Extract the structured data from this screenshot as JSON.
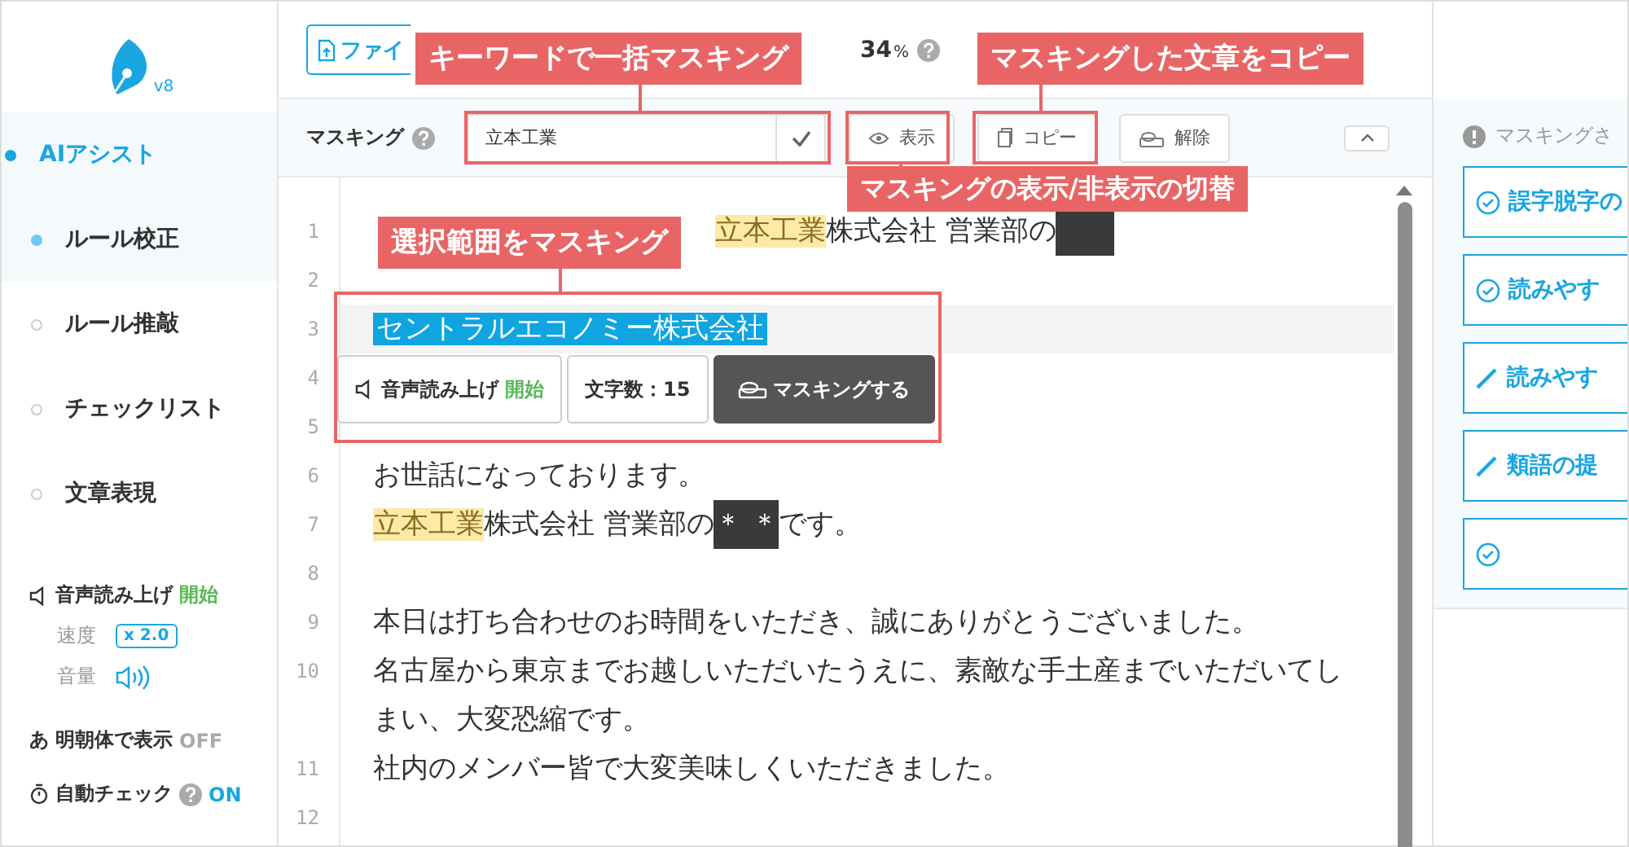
{
  "logo": {
    "version": "v8"
  },
  "sidebar": {
    "items": [
      {
        "label": "AIアシスト",
        "selected": true,
        "active": true
      },
      {
        "label": "ルール校正",
        "selected": false,
        "active": true
      },
      {
        "label": "ルール推敲",
        "selected": false,
        "active": false
      },
      {
        "label": "チェックリスト",
        "selected": false,
        "active": false
      },
      {
        "label": "文章表現",
        "selected": false,
        "active": false
      }
    ],
    "speech": {
      "label": "音声読み上げ",
      "action": "開始",
      "speed_label": "速度",
      "speed": "x 2.0",
      "volume_label": "音量"
    },
    "mincho": {
      "icon": "あ",
      "label": "明朝体で表示",
      "on": false,
      "state": "OFF"
    },
    "auto_check": {
      "label": "自動チェック",
      "on": true,
      "state": "ON"
    }
  },
  "top_bar": {
    "file_button": "ファイ",
    "score": {
      "value": "34",
      "unit": "%"
    }
  },
  "masking_bar": {
    "label": "マスキング",
    "keyword": "立本工業",
    "buttons": [
      {
        "kind": "eye",
        "label": "表示"
      },
      {
        "kind": "copy",
        "label": "コピー"
      },
      {
        "kind": "unmask",
        "label": "解除"
      }
    ]
  },
  "editor": {
    "lines": [
      {
        "number": "1",
        "segments": [
          {
            "kind": "keyword",
            "text": "立本工業"
          },
          {
            "kind": "text",
            "text": "株式会社 営業部の"
          },
          {
            "kind": "mask"
          }
        ]
      },
      {
        "number": "2"
      },
      {
        "number": "3",
        "current": true,
        "segments": [
          {
            "kind": "selected",
            "text": "セントラルエコノミー株式会社"
          }
        ]
      },
      {
        "number": "4"
      },
      {
        "number": "5"
      },
      {
        "number": "6",
        "segments": [
          {
            "kind": "text",
            "text": "お世話になっております。"
          }
        ]
      },
      {
        "number": "7",
        "segments": [
          {
            "kind": "keyword",
            "text": "立本工業"
          },
          {
            "kind": "text",
            "text": "株式会社 営業部の"
          },
          {
            "kind": "mask",
            "text": "＊ ＊"
          },
          {
            "kind": "text",
            "text": "です。"
          }
        ]
      },
      {
        "number": "8"
      },
      {
        "number": "9",
        "segments": [
          {
            "kind": "text",
            "text": "本日は打ち合わせのお時間をいただき、誠にありがとうございました。"
          }
        ]
      },
      {
        "number": "10",
        "segments": [
          {
            "kind": "text",
            "text": "名古屋から東京までお越しいただいたうえに、素敵な手土産までいただいてしまい、大変恐縮です。"
          }
        ]
      },
      {
        "number": "11",
        "segments": [
          {
            "kind": "text",
            "text": "社内のメンバー皆で大変美味しくいただきました。"
          }
        ]
      },
      {
        "number": "12"
      }
    ],
    "popup": {
      "speech": "音声読み上げ",
      "speech_action": "開始",
      "char_count": "文字数：15",
      "mask_button": "マスキングする"
    }
  },
  "right_panel": {
    "notice": "マスキングさ",
    "cards": [
      {
        "kind": "check",
        "label": "誤字脱字の"
      },
      {
        "kind": "check",
        "label": "読みやす"
      },
      {
        "kind": "pen",
        "label": "読みやす"
      },
      {
        "kind": "pen",
        "label": "類語の提"
      },
      {
        "kind": "check"
      }
    ]
  },
  "annotations": [
    {
      "text": "キーワードで一括マスキング"
    },
    {
      "text": "マスキングした文章をコピー"
    },
    {
      "text": "マスキングの表示/非表示の切替"
    },
    {
      "text": "選択範囲をマスキング"
    }
  ]
}
